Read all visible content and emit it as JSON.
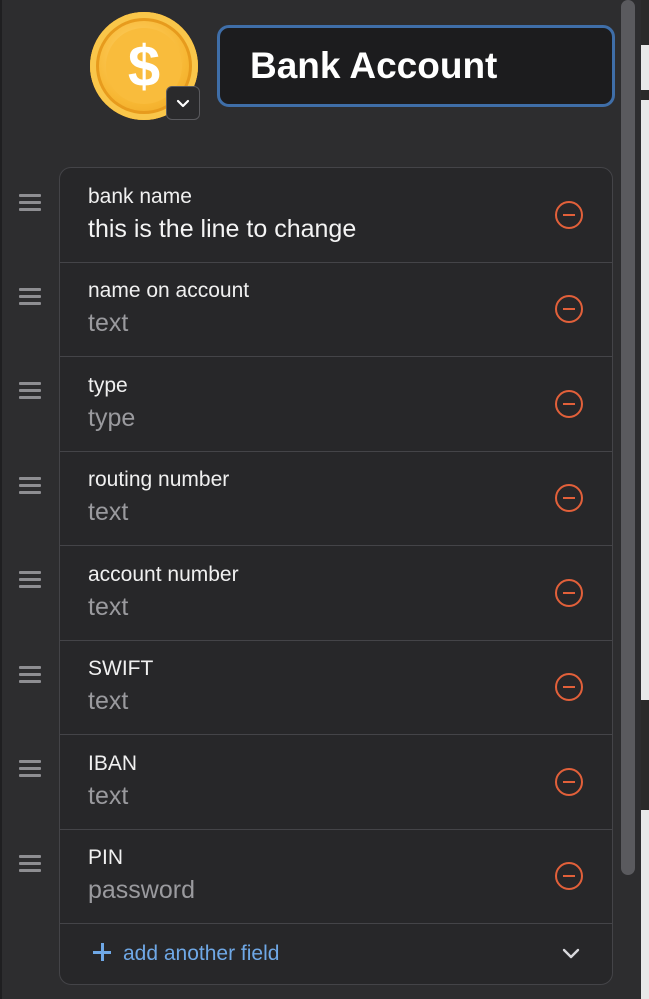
{
  "header": {
    "title": "Bank Account",
    "icon": "dollar-coin-icon"
  },
  "fields": [
    {
      "label": "bank name",
      "value": "this is the line to change",
      "filled": true
    },
    {
      "label": "name on account",
      "value": "text",
      "filled": false
    },
    {
      "label": "type",
      "value": "type",
      "filled": false
    },
    {
      "label": "routing number",
      "value": "text",
      "filled": false
    },
    {
      "label": "account number",
      "value": "text",
      "filled": false
    },
    {
      "label": "SWIFT",
      "value": "text",
      "filled": false
    },
    {
      "label": "IBAN",
      "value": "text",
      "filled": false
    },
    {
      "label": "PIN",
      "value": "password",
      "filled": false
    }
  ],
  "add_field": {
    "label": "add another field"
  },
  "colors": {
    "accent_blue": "#6fa8e6",
    "remove_orange": "#e2603a",
    "title_border": "#3f6ea8"
  }
}
